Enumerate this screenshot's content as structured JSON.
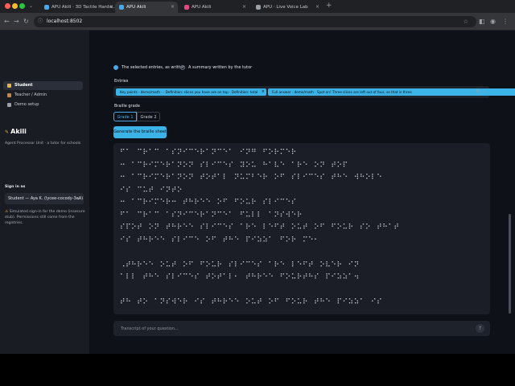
{
  "browser": {
    "tabs": [
      {
        "label": "APU Akili · 3D Tactile Hardw...",
        "active": false,
        "fav": "#4aa8e8"
      },
      {
        "label": "APU Akili",
        "active": true,
        "fav": "#4aa8e8"
      },
      {
        "label": "APU Akili",
        "active": false,
        "fav": "#e64980"
      },
      {
        "label": "APU · Live Voice Lab",
        "active": false,
        "fav": "#9aa0a6"
      }
    ],
    "new_tab": "+",
    "url": "localhost:8502"
  },
  "sidebar": {
    "nav": [
      {
        "label": "Student",
        "active": true,
        "icon": "student-icon",
        "color": "#e8b04a"
      },
      {
        "label": "Teacher / Admin",
        "active": false,
        "icon": "teacher-icon",
        "color": "#c9844a"
      },
      {
        "label": "Demo setup",
        "active": false,
        "icon": "gear-icon",
        "color": "#9aa0a6"
      }
    ],
    "brand": "Akili",
    "tagline": "Agent Processor Unit · a tutor for schools",
    "sign_in_label": "Sign in as",
    "user": "Student — Aya K. (lycee-cocody-3eA)",
    "notice": "Simulated sign-in for the demo (insecure stub). Permissions still come from the registries."
  },
  "main": {
    "radio_written": "The selected entries, as written",
    "radio_summary": "A summary written by the tutor",
    "entries_label": "Entries",
    "chips": [
      "Key points · demo/math · · Definition: slices you have are on top · Definition: total",
      "Full answer · demo/math · Spot on! Three slices are left out of four, so that is three"
    ],
    "grade_label": "Braille grade",
    "grades": [
      "Grade 1",
      "Grade 2"
    ],
    "generate_label": "Generate the braille sheet",
    "braille_lines": [
      "⠋⠁⠀⠉⠗⠁⠉⠀⠁⠎⠝⠊⠉⠑⠗⠁⠝⠉⠑⠁⠀⠊⠝⠛⠀⠋⠕⠗⠍⠑⠗⠀",
      "⠒⠀⠁⠉⠗⠊⠍⠑⠗⠁⠝⠕⠝⠀⠎⠇⠊⠉⠑⠎⠀⠽⠕⠥⠀⠓⠁⠧⠑⠀⠁⠗⠑⠀⠕⠝⠀⠞⠕⠏",
      "⠒⠀⠁⠉⠗⠊⠍⠑⠗⠁⠝⠕⠝⠀⠞⠕⠞⠁⠇⠀⠝⠥⠍⠃⠑⠗⠀⠕⠋⠀⠎⠇⠊⠉⠑⠎⠀⠞⠓⠑⠀⠺⠓⠕⠇⠑",
      "⠊⠎⠀⠉⠥⠞⠀⠊⠝⠞⠕",
      "⠒⠀⠁⠉⠗⠊⠍⠑⠗⠒⠀⠞⠓⠗⠑⠑⠀⠕⠋⠀⠋⠕⠥⠗⠀⠎⠇⠊⠉⠑⠎",
      "⠋⠁⠀⠉⠗⠁⠉⠀⠁⠎⠝⠊⠉⠑⠗⠁⠝⠉⠑⠁⠀⠋⠥⠇⠇⠀⠁⠝⠎⠺⠑⠗",
      "⠎⠏⠕⠞⠀⠕⠝⠀⠞⠓⠗⠑⠑⠀⠎⠇⠊⠉⠑⠎⠀⠁⠗⠑⠀⠇⠑⠋⠞⠀⠕⠥⠞⠀⠕⠋⠀⠋⠕⠥⠗⠀⠎⠕⠀⠞⠓⠁⠞",
      "⠊⠎⠀⠞⠓⠗⠑⠑⠀⠎⠇⠊⠉⠑⠀⠕⠋⠀⠞⠓⠑⠀⠏⠊⠵⠵⠁⠀⠋⠕⠗⠀⠍⠑⠂",
      "",
      "⠠⠞⠓⠗⠑⠑⠀⠕⠥⠞⠀⠕⠋⠀⠋⠕⠥⠗⠀⠎⠇⠊⠉⠑⠎⠀⠁⠗⠑⠀⠇⠑⠋⠞⠀⠕⠧⠑⠗⠀⠊⠝",
      "⠁⠇⠇⠀⠞⠓⠑⠀⠎⠇⠊⠉⠑⠎⠀⠞⠕⠞⠁⠇⠂⠀⠞⠓⠗⠑⠑⠀⠋⠕⠥⠗⠞⠓⠎⠀⠏⠊⠵⠵⠁⠲",
      "",
      "⠞⠓⠀⠞⠕⠀⠁⠝⠎⠺⠑⠗⠀⠊⠎⠀⠞⠓⠗⠑⠑⠀⠕⠥⠞⠀⠕⠋⠀⠋⠕⠥⠗⠀⠞⠓⠑⠀⠏⠊⠵⠵⠁⠀⠊⠎"
    ],
    "chat_placeholder": "Transcript of your question..."
  }
}
